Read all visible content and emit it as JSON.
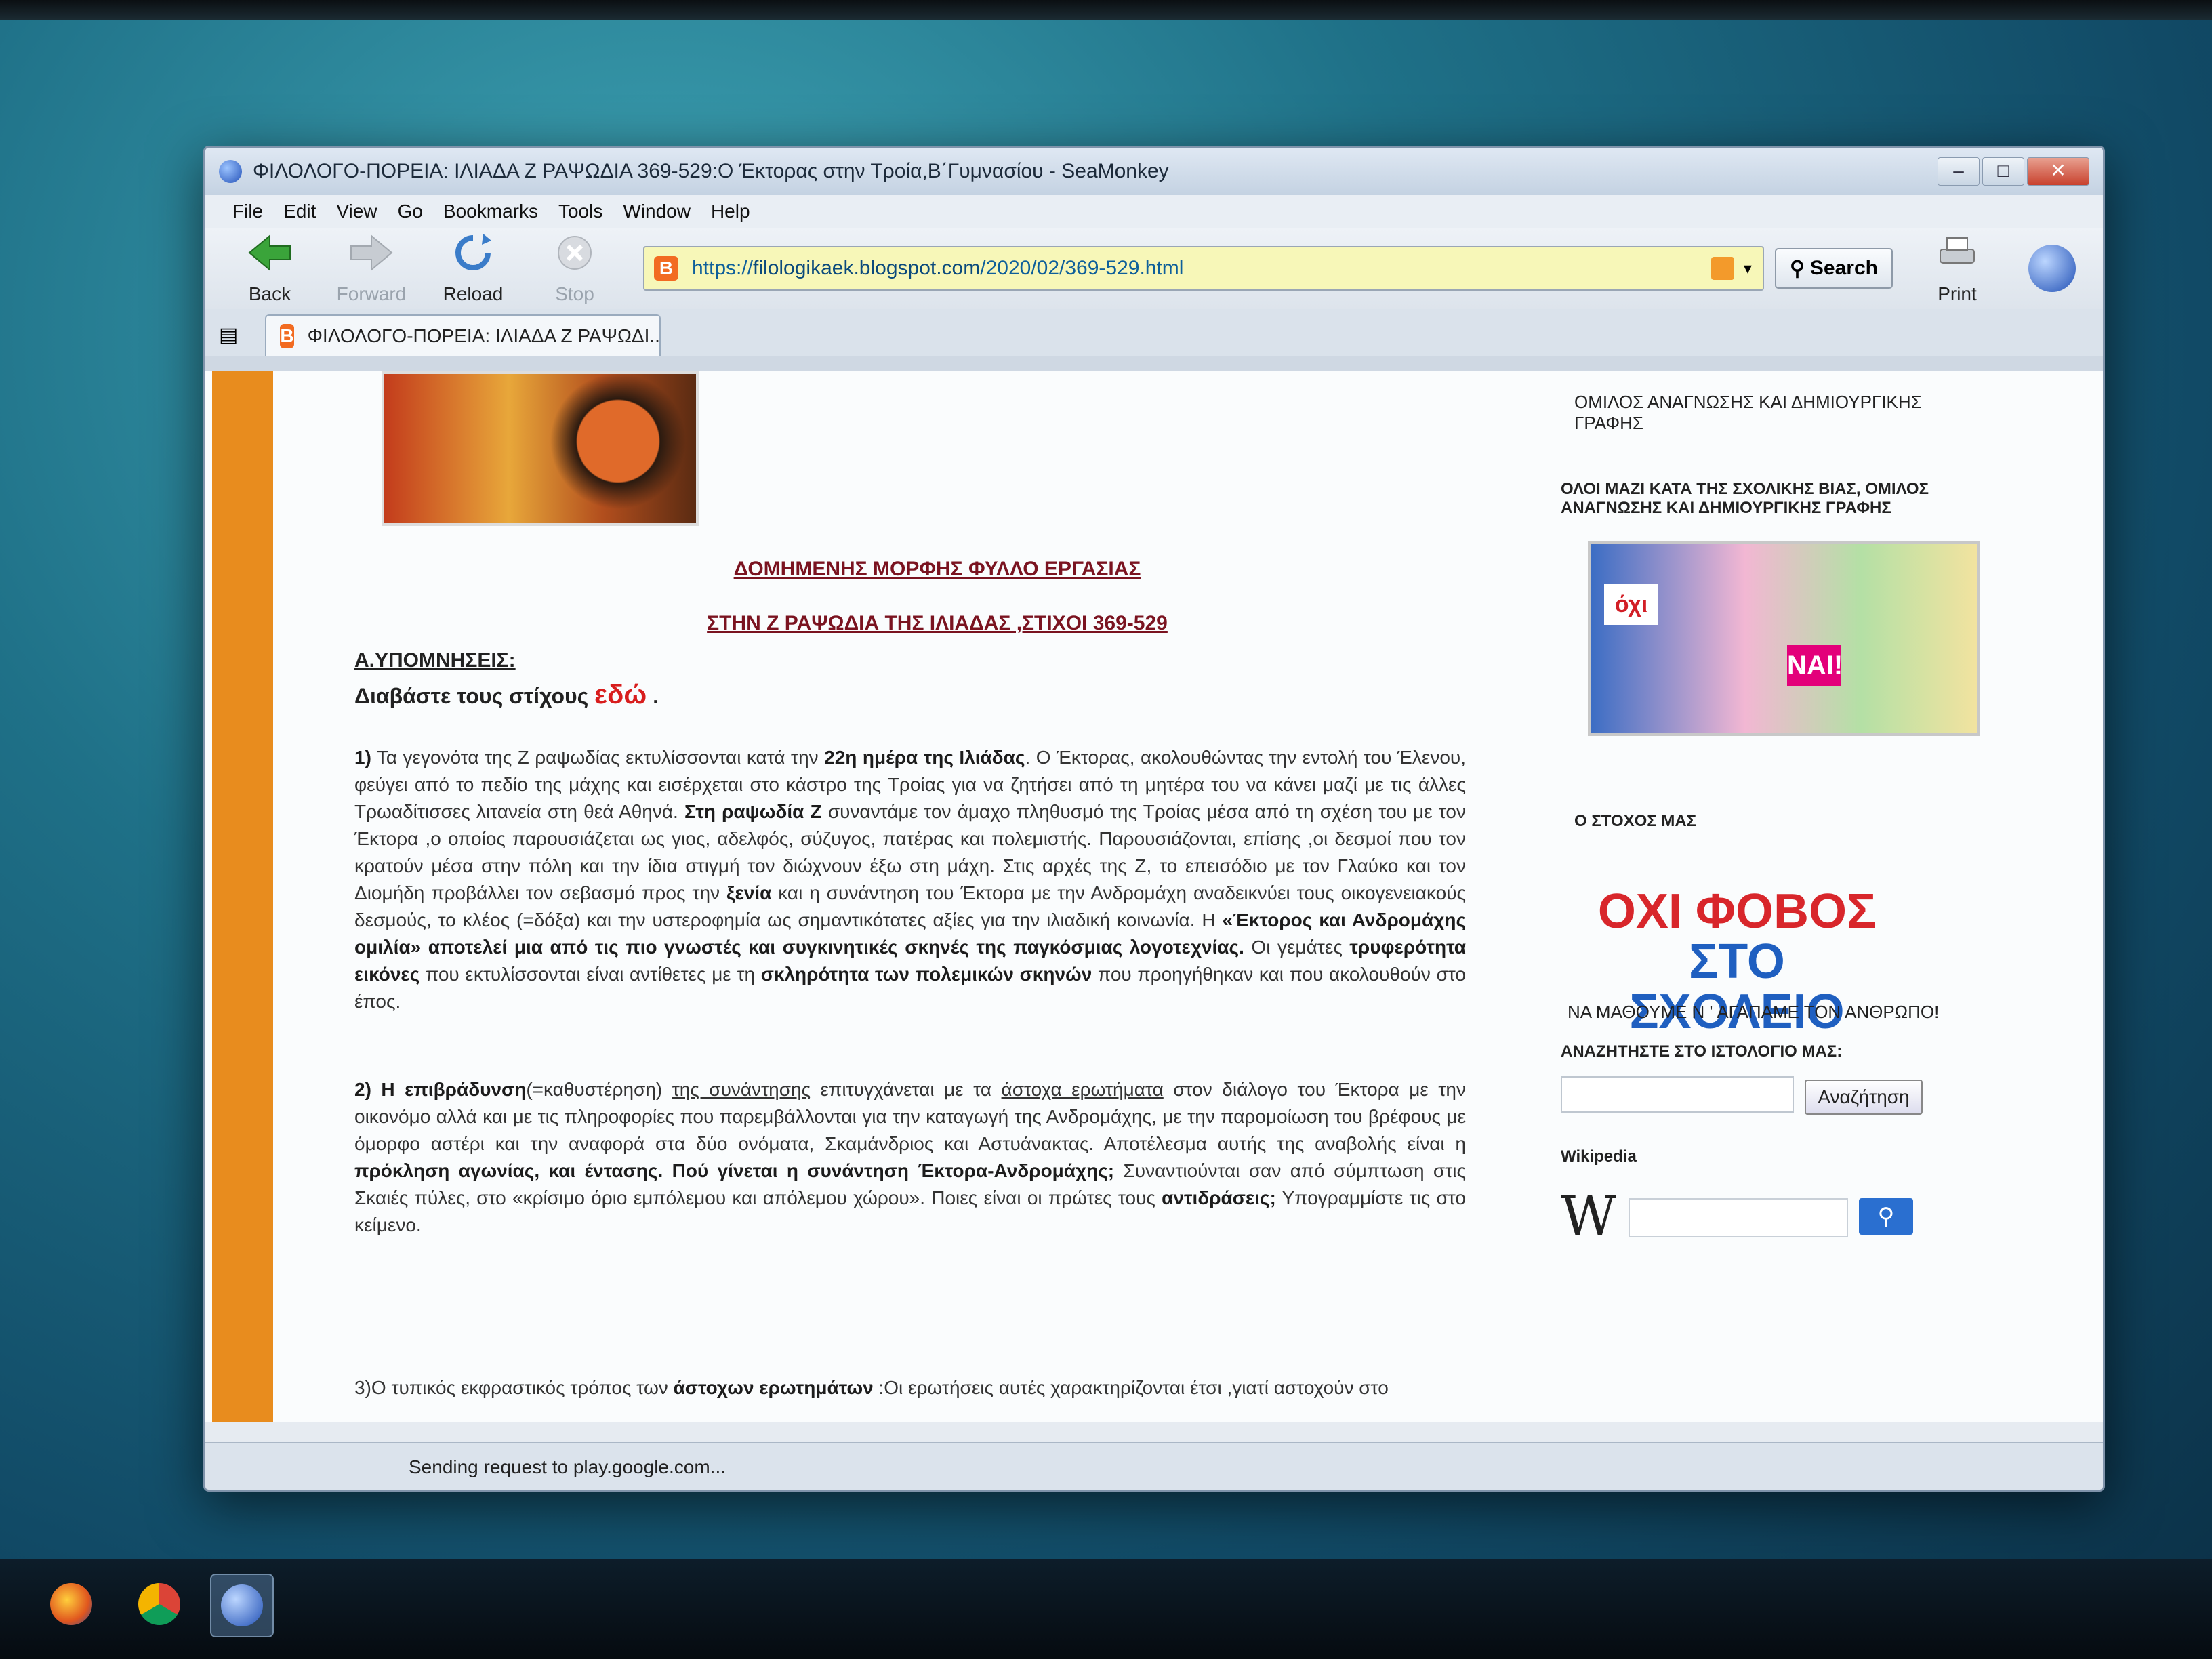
{
  "window": {
    "title": "ΦΙΛΟΛΟΓΟ-ΠΟΡΕΙΑ: ΙΛΙΑΔΑ Ζ ΡΑΨΩΔΙΑ 369-529:Ο Έκτορας στην Τροία,Β΄Γυμνασίου - SeaMonkey",
    "controls": {
      "minimize": "–",
      "maximize": "□",
      "close": "✕"
    }
  },
  "menu": [
    "File",
    "Edit",
    "View",
    "Go",
    "Bookmarks",
    "Tools",
    "Window",
    "Help"
  ],
  "toolbar": {
    "back": "Back",
    "forward": "Forward",
    "reload": "Reload",
    "stop": "Stop",
    "search": "Search",
    "print": "Print"
  },
  "address": {
    "scheme": "https://",
    "host": "filologikaek.blogspot.com",
    "path": "/2020/02/369-529.html"
  },
  "tab": {
    "label": "ΦΙΛΟΛΟΓΟ-ΠΟΡΕΙΑ: ΙΛΙΑΔΑ Ζ ΡΑΨΩΔΙ..."
  },
  "article": {
    "title1": "ΔΟΜΗΜΕΝΗΣ ΜΟΡΦΗΣ ΦΥΛΛΟ ΕΡΓΑΣΙΑΣ",
    "title2": "ΣΤΗΝ Ζ ΡΑΨΩΔΙΑ ΤΗΣ ΙΛΙΑΔΑΣ ,ΣΤΙΧΟΙ 369-529",
    "section": "Α.ΥΠΟΜΝΗΣΕΙΣ:",
    "lead_prefix": "Διαβάστε τους στίχους",
    "lead_link": "εδώ",
    "lead_suffix": ".",
    "p1": {
      "num": "1)",
      "t1": " Τα γεγονότα της Ζ ραψωδίας εκτυλίσσονται κατά την ",
      "b1": "22η ημέρα της Ιλιάδας",
      "t2": ". Ο Έκτορας, ακολουθώντας την εντολή του Έλενου, φεύγει από το πεδίο της μάχης και εισέρχεται στο κάστρο της Τροίας για να ζητήσει από τη μητέρα του να κάνει μαζί με τις άλλες Τρωαδίτισσες λιτανεία στη θεά Αθηνά. ",
      "b2": "Στη ραψωδία Ζ",
      "t3": " συναντάμε τον άμαχο πληθυσμό της Τροίας μέσα από τη σχέση του με τον Έκτορα ,ο οποίος παρουσιάζεται ως γιος, αδελφός, σύζυγος, πατέρας και πολεμιστής. Παρουσιάζονται, επίσης ,οι δεσμοί που τον κρατούν μέσα στην πόλη και την ίδια στιγμή τον διώχνουν έξω στη μάχη. Στις αρχές της Ζ, το επεισόδιο με τον Γλαύκο και τον Διομήδη προβάλλει τον σεβασμό προς την ",
      "b3": "ξενία",
      "t4": " και η συνάντηση του Έκτορα με την Ανδρομάχη αναδεικνύει τους οικογενειακούς δεσμούς, το κλέος (=δόξα) και την υστεροφημία ως σημαντικότατες αξίες για την ιλιαδική κοινωνία. Η ",
      "b4": "«Έκτορος και Ανδρομάχης ομιλία» αποτελεί μια από τις πιο γνωστές και συγκινητικές σκηνές της παγκόσμιας λογοτεχνίας.",
      "t5": " Οι γεμάτες ",
      "b5": "τρυφερότητα εικόνες",
      "t6": " που εκτυλίσσονται είναι αντίθετες με τη ",
      "b6": "σκληρότητα των πολεμικών σκηνών",
      "t7": " που προηγήθηκαν και που ακολουθούν στο έπος."
    },
    "p2": {
      "b1": "2) Η επιβράδυνση",
      "t1": "(=καθυστέρηση) ",
      "u1": "της συνάντησης",
      "t2": " επιτυγχάνεται με τα ",
      "u2": "άστοχα ερωτήματα",
      "t3": " στον διάλογο του Έκτορα με την οικονόμο αλλά και με τις πληροφορίες που παρεμβάλλονται για την καταγωγή της Ανδρομάχης, με την παρομοίωση του βρέφους με όμορφο αστέρι και την αναφορά στα δύο ονόματα, Σκαμάνδριος και Αστυάνακτας. Αποτέλεσμα αυτής της αναβολής είναι η ",
      "b2": "πρόκληση αγωνίας, και έντασης.",
      "b3": "Πού γίνεται η συνάντηση Έκτορα-Ανδρομάχης;",
      "t4": " Συναντιούνται σαν από σύμπτωση στις Σκαιές πύλες, στο «κρίσιμο όριο εμπόλεμου και απόλεμου χώρου». Ποιες είναι οι πρώτες τους ",
      "b4": "αντιδράσεις;",
      "t5": " Υπογραμμίστε τις στο κείμενο."
    },
    "p3": {
      "t1": "3)Ο τυπικός εκφραστικός τρόπος των ",
      "b1": "άστοχων ερωτημάτων",
      "t2": " :Οι ερωτήσεις αυτές χαρακτηρίζονται έτσι ,γιατί αστοχούν στο"
    }
  },
  "sidebar": {
    "club": "ΟΜΙΛΟΣ ΑΝΑΓΝΩΣΗΣ ΚΑΙ ΔΗΜΙΟΥΡΓΙΚΗΣ ΓΡΑΦΗΣ",
    "violence_head": "ΟΛΟΙ ΜΑΖΙ ΚΑΤΑ ΤΗΣ ΣΧΟΛΙΚΗΣ ΒΙΑΣ, ΟΜΙΛΟΣ ΑΝΑΓΝΩΣΗΣ ΚΑΙ ΔΗΜΙΟΥΡΓΙΚΗΣ ΓΡΑΦΗΣ",
    "poster_oxi": "όχι",
    "poster_nai": "ΝΑΙ!",
    "goal_head": "Ο ΣΤΟΧΟΣ ΜΑΣ",
    "slogan_line1": "ΟΧΙ ΦΟΒΟΣ",
    "slogan_line2": "ΣΤΟ ΣΧΟΛΕΙΟ",
    "goal_caption": "ΝΑ ΜΑΘΟΥΜΕ Ν ' ΑΓΑΠΑΜΕ ΤΟΝ ΑΝΘΡΩΠΟ!",
    "search_head": "ΑΝΑΖΗΤΗΣΤΕ ΣΤΟ ΙΣΤΟΛΟΓΙΟ ΜΑΣ:",
    "search_btn": "Αναζήτηση",
    "wiki_head": "Wikipedia",
    "wiki_logo": "W"
  },
  "status": {
    "text": "Sending request to play.google.com..."
  },
  "colors": {
    "accent_orange": "#e88c1e",
    "title_red": "#7a1320",
    "link_red": "#d81d1d",
    "wiki_blue": "#2a6fd0"
  }
}
